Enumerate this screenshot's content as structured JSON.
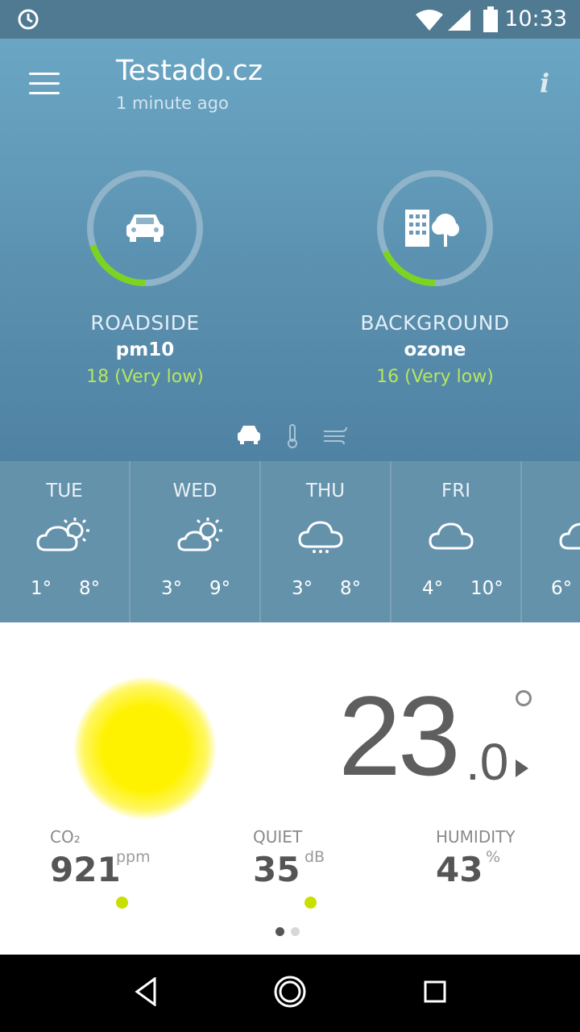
{
  "status_bar": {
    "time": "10:33",
    "icons": [
      "alarm-icon",
      "wifi-icon",
      "signal-icon",
      "battery-icon"
    ]
  },
  "header": {
    "title": "Testado.cz",
    "subtitle": "1 minute ago",
    "menu_icon": "hamburger-menu-icon",
    "info_label": "i"
  },
  "gauges": [
    {
      "category": "ROADSIDE",
      "pollutant": "pm10",
      "level": "18 (Very low)",
      "icon": "car-icon",
      "fill_fraction": 0.2
    },
    {
      "category": "BACKGROUND",
      "pollutant": "ozone",
      "level": "16 (Very low)",
      "icon": "building-tree-icon",
      "fill_fraction": 0.18
    }
  ],
  "page_icons": [
    "car-icon",
    "thermometer-icon",
    "wind-icon"
  ],
  "forecast": [
    {
      "day": "TUE",
      "low": "1°",
      "high": "8°",
      "icon": "partly-cloudy-icon"
    },
    {
      "day": "WED",
      "low": "3°",
      "high": "9°",
      "icon": "partly-sunny-icon"
    },
    {
      "day": "THU",
      "low": "3°",
      "high": "8°",
      "icon": "drizzle-icon"
    },
    {
      "day": "FRI",
      "low": "4°",
      "high": "10°",
      "icon": "cloudy-icon"
    },
    {
      "day": "S",
      "low": "6°",
      "high": "",
      "icon": "cloudy-icon"
    }
  ],
  "indoor": {
    "temperature": "23",
    "temperature_decimal": ".0",
    "degree_symbol": "°",
    "metrics": [
      {
        "label": "CO₂",
        "value": "921",
        "unit": "ppm"
      },
      {
        "label": "QUIET",
        "value": "35",
        "unit": "dB"
      },
      {
        "label": "HUMIDITY",
        "value": "43",
        "unit": "%"
      }
    ],
    "page_indicator": {
      "current": 1,
      "total": 2
    }
  },
  "colors": {
    "accent_green": "#7ed321",
    "level_text": "#b7e65f",
    "sun_yellow": "#fff200",
    "status_dot": "#c8e000"
  }
}
